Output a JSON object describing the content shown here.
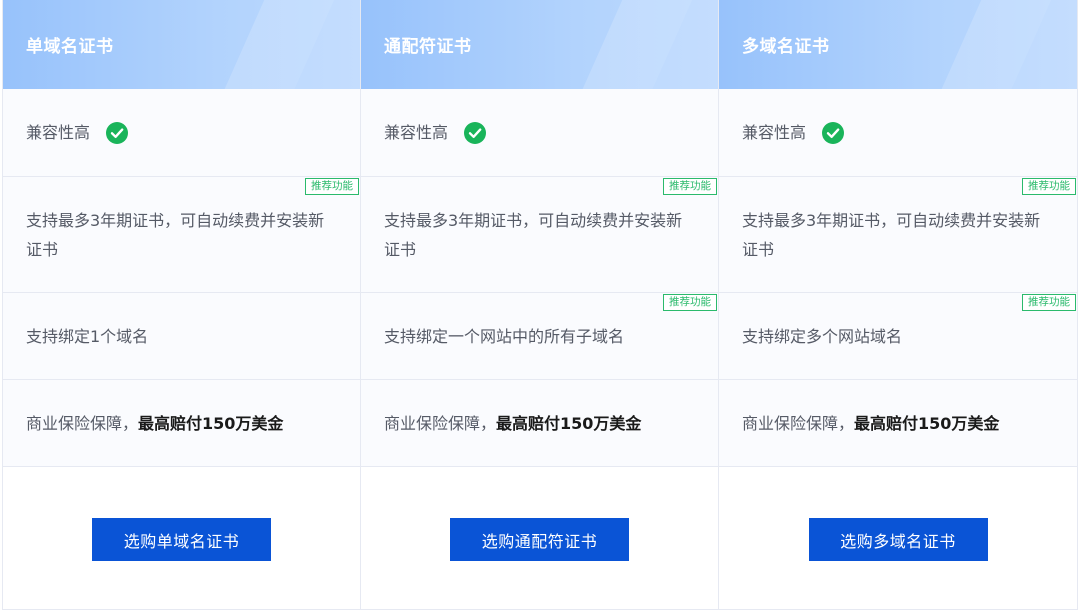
{
  "colors": {
    "header_gradient_start": "#97c2fb",
    "header_gradient_end": "#bcd9fe",
    "check_green": "#19b45a",
    "badge_green": "#2bba6c",
    "button_blue": "#0a54d6"
  },
  "columns": [
    {
      "title": "单域名证书",
      "compat_label": "兼容性高",
      "compat_icon": "check-circle-icon",
      "renew_text": "支持最多3年期证书，可自动续费并安装新证书",
      "renew_badge": "推荐功能",
      "bind_text": "支持绑定1个域名",
      "bind_badge": "",
      "insure_prefix": "商业保险保障，",
      "insure_highlight": "最高赔付150万美金",
      "button_label": "选购单域名证书"
    },
    {
      "title": "通配符证书",
      "compat_label": "兼容性高",
      "compat_icon": "check-circle-icon",
      "renew_text": "支持最多3年期证书，可自动续费并安装新证书",
      "renew_badge": "推荐功能",
      "bind_text": "支持绑定一个网站中的所有子域名",
      "bind_badge": "推荐功能",
      "insure_prefix": "商业保险保障，",
      "insure_highlight": "最高赔付150万美金",
      "button_label": "选购通配符证书"
    },
    {
      "title": "多域名证书",
      "compat_label": "兼容性高",
      "compat_icon": "check-circle-icon",
      "renew_text": "支持最多3年期证书，可自动续费并安装新证书",
      "renew_badge": "推荐功能",
      "bind_text": "支持绑定多个网站域名",
      "bind_badge": "推荐功能",
      "insure_prefix": "商业保险保障，",
      "insure_highlight": "最高赔付150万美金",
      "button_label": "选购多域名证书"
    }
  ]
}
